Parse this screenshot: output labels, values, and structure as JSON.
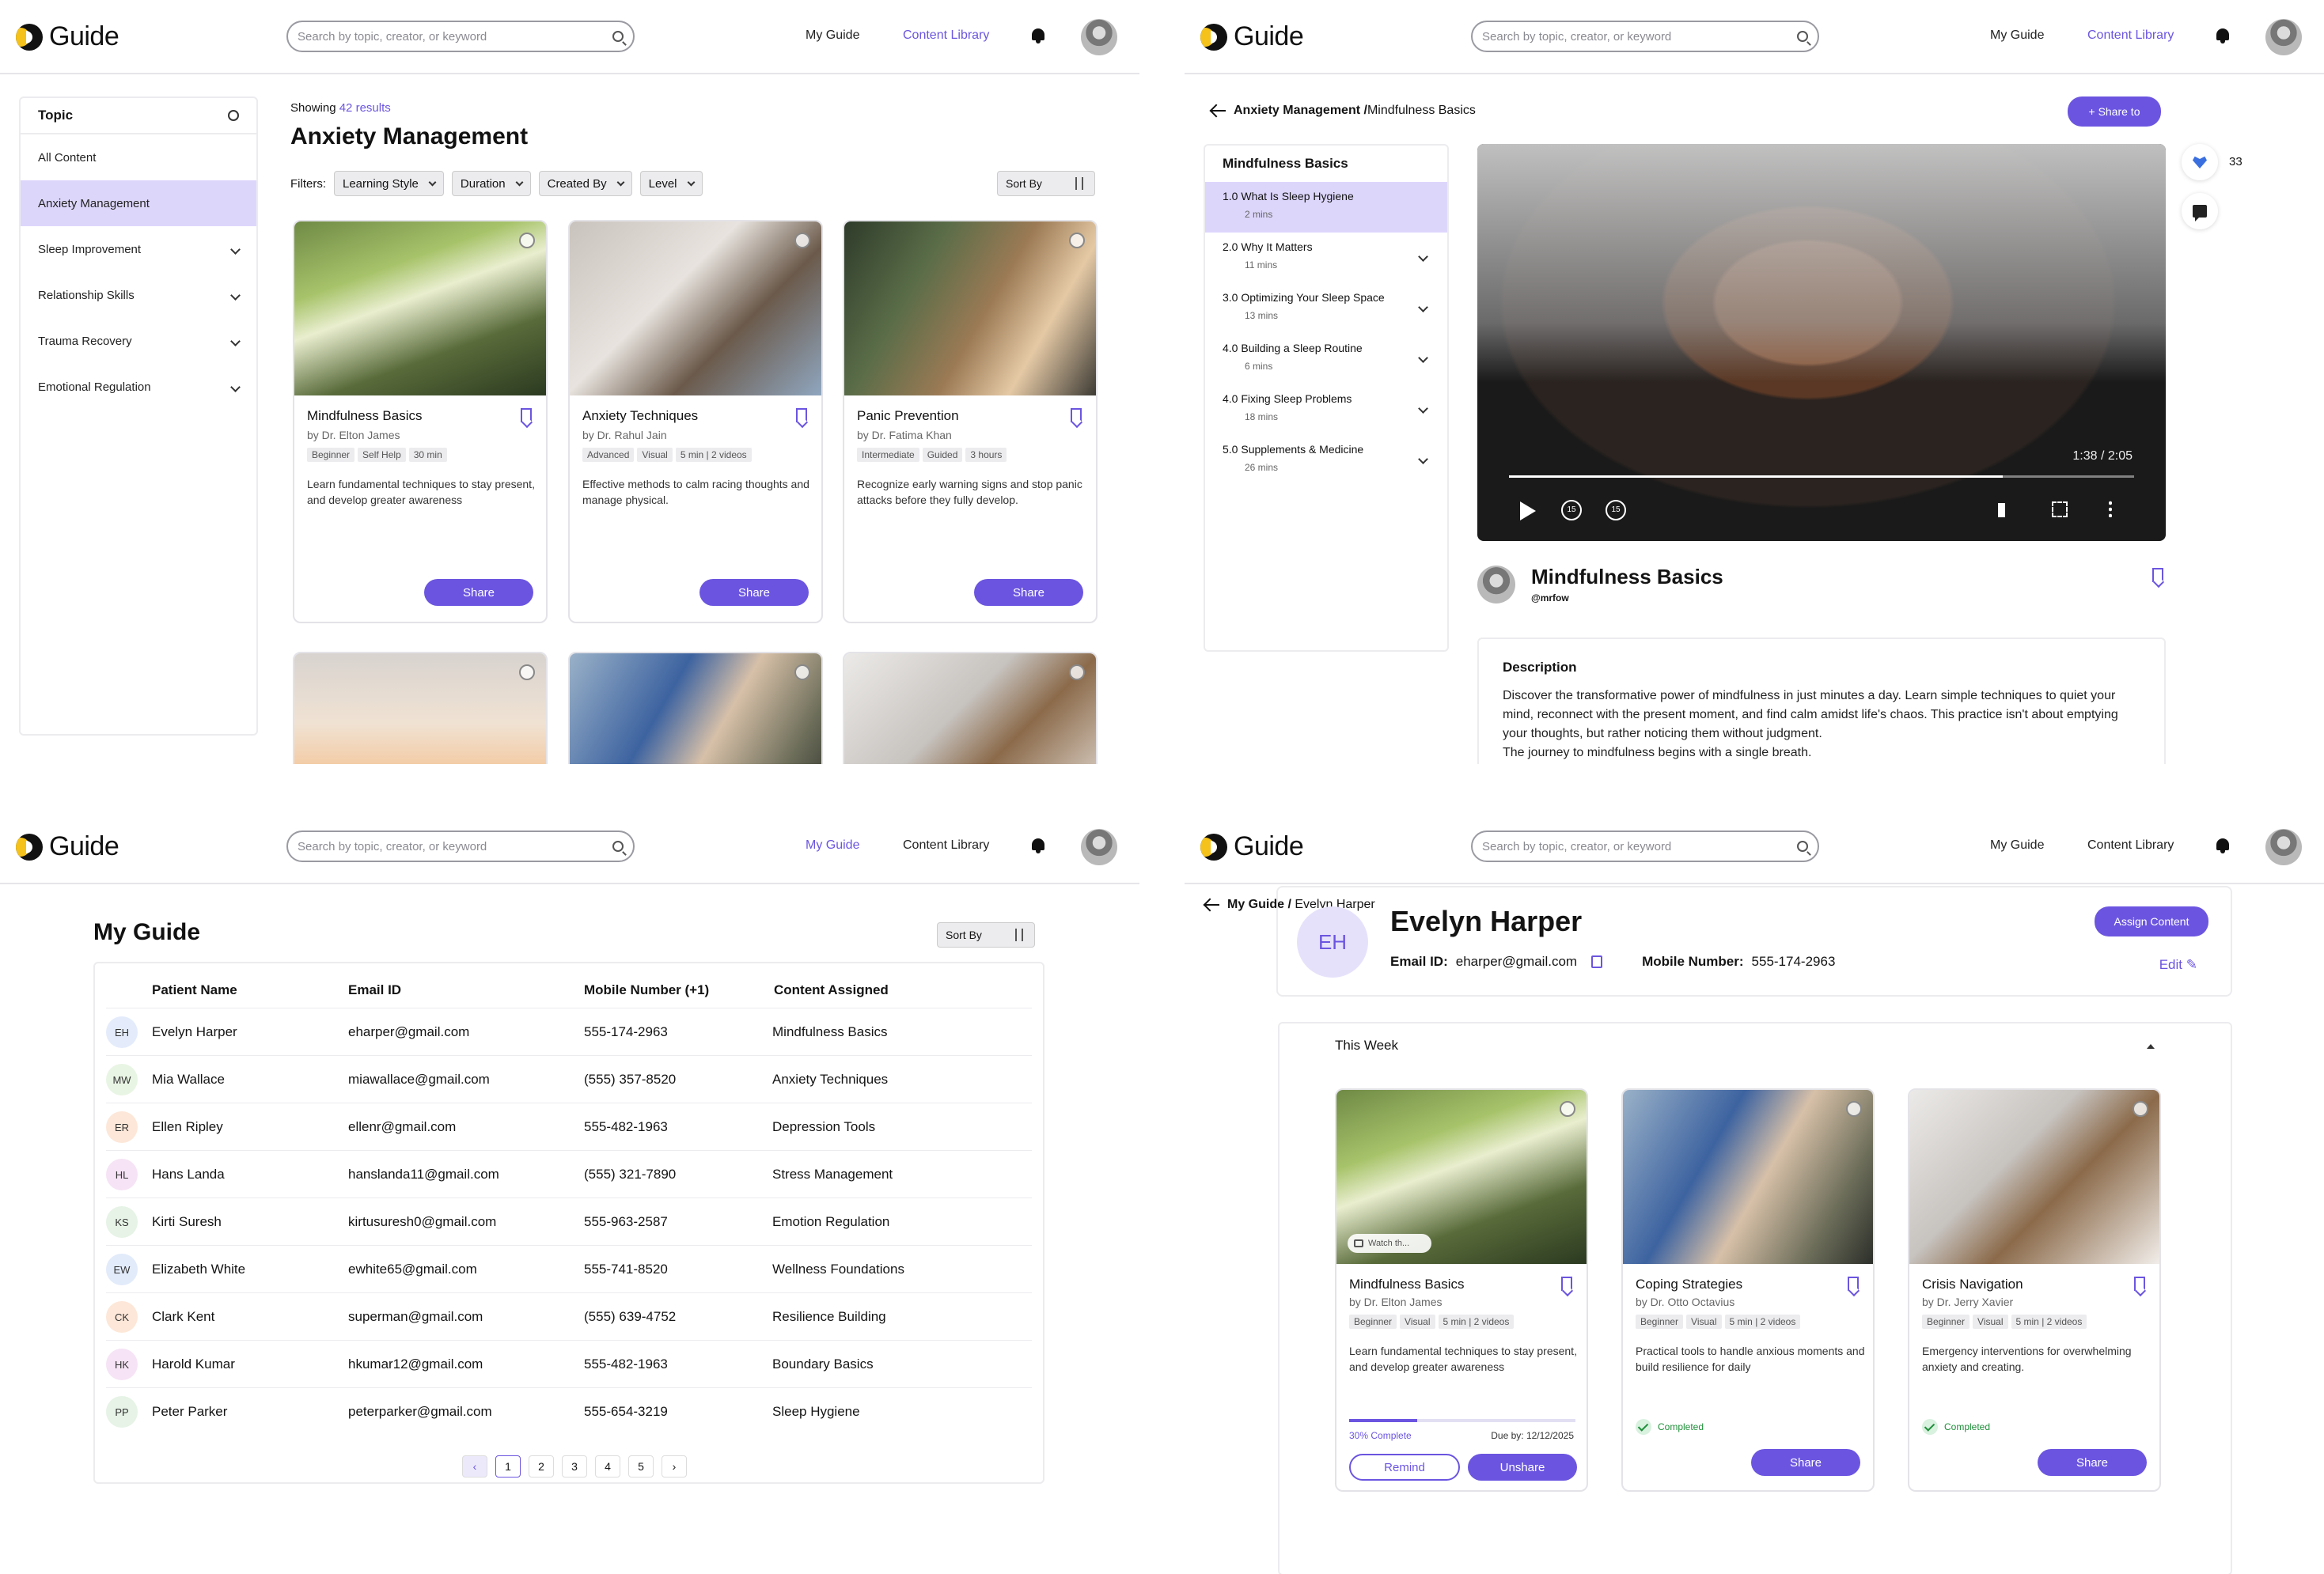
{
  "common": {
    "brand": "Guide",
    "search_placeholder": "Search by topic, creator, or keyword",
    "nav_my_guide": "My Guide",
    "nav_content_library": "Content Library",
    "accent": "#6b55e0"
  },
  "library": {
    "topic_header": "Topic",
    "topics": [
      "All Content",
      "Anxiety Management",
      "Sleep Improvement",
      "Relationship Skills",
      "Trauma Recovery",
      "Emotional Regulation"
    ],
    "selected_topic": "Anxiety Management",
    "showing_prefix": "Showing",
    "results": "42 results",
    "title": "Anxiety Management",
    "filters_label": "Filters:",
    "filters": [
      "Learning Style",
      "Duration",
      "Created By",
      "Level"
    ],
    "sort_by": "Sort By",
    "share_label": "Share",
    "cards": [
      {
        "title": "Mindfulness Basics",
        "author": "by Dr. Elton James",
        "tags": [
          "Beginner",
          "Self Help",
          "30 min"
        ],
        "desc": "Learn fundamental techniques to stay present, and develop greater awareness"
      },
      {
        "title": "Anxiety Techniques",
        "author": "by Dr. Rahul Jain",
        "tags": [
          "Advanced",
          "Visual",
          "5 min | 2 videos"
        ],
        "desc": "Effective methods to calm racing thoughts and manage physical."
      },
      {
        "title": "Panic Prevention",
        "author": "by Dr. Fatima Khan",
        "tags": [
          "Intermediate",
          "Guided",
          "3 hours"
        ],
        "desc": "Recognize early warning signs and stop panic attacks before they fully develop."
      }
    ]
  },
  "detail": {
    "breadcrumb_parent": "Anxiety Management /",
    "breadcrumb_current": "Mindfulness Basics",
    "share_to": "Share to",
    "curriculum_title": "Mindfulness Basics",
    "lessons": [
      {
        "title": "1.0 What Is Sleep Hygiene",
        "duration": "2 mins"
      },
      {
        "title": "2.0 Why It Matters",
        "duration": "11 mins"
      },
      {
        "title": "3.0 Optimizing Your Sleep Space",
        "duration": "13 mins"
      },
      {
        "title": "4.0 Building a Sleep Routine",
        "duration": "6 mins"
      },
      {
        "title": "4.0 Fixing Sleep Problems",
        "duration": "18 mins"
      },
      {
        "title": "5.0 Supplements & Medicine",
        "duration": "26 mins"
      }
    ],
    "video_time": "1:38 / 2:05",
    "video_progress": 0.79,
    "skip_back": "15",
    "skip_forward": "15",
    "likes": "33",
    "owner_title": "Mindfulness Basics",
    "owner_handle": "@mrfow",
    "description_title": "Description",
    "description": "Discover the transformative power of mindfulness in just minutes a day. Learn simple techniques to quiet your mind, reconnect with the present moment, and find calm amidst life's chaos. This practice isn't about emptying your thoughts, but rather noticing them without judgment.",
    "description_2": "The journey to mindfulness begins with a single breath."
  },
  "my_guide": {
    "title": "My Guide",
    "sort_by": "Sort By",
    "columns": [
      "Patient Name",
      "Email ID",
      "Mobile Number (+1)",
      "Content Assigned"
    ],
    "rows": [
      {
        "initials": "EH",
        "name": "Evelyn Harper",
        "email": "eharper@gmail.com",
        "mobile": "555-174-2963",
        "content": "Mindfulness Basics",
        "color": "#e4ecfb"
      },
      {
        "initials": "MW",
        "name": "Mia Wallace",
        "email": "miawallace@gmail.com",
        "mobile": "(555) 357-8520",
        "content": "Anxiety Techniques",
        "color": "#e9f5e4"
      },
      {
        "initials": "ER",
        "name": "Ellen Ripley",
        "email": "ellenr@gmail.com",
        "mobile": "555-482-1963",
        "content": "Depression Tools",
        "color": "#fde7d8"
      },
      {
        "initials": "HL",
        "name": "Hans Landa",
        "email": "hanslanda11@gmail.com",
        "mobile": "(555) 321-7890",
        "content": "Stress Management",
        "color": "#f6e3f5"
      },
      {
        "initials": "KS",
        "name": "Kirti Suresh",
        "email": "kirtusuresh0@gmail.com",
        "mobile": "555-963-2587",
        "content": "Emotion Regulation",
        "color": "#e6f3e6"
      },
      {
        "initials": "EW",
        "name": "Elizabeth White",
        "email": "ewhite65@gmail.com",
        "mobile": "555-741-8520",
        "content": "Wellness Foundations",
        "color": "#e2ebfa"
      },
      {
        "initials": "CK",
        "name": "Clark Kent",
        "email": "superman@gmail.com",
        "mobile": "(555) 639-4752",
        "content": "Resilience Building",
        "color": "#fde7d8"
      },
      {
        "initials": "HK",
        "name": "Harold Kumar",
        "email": "hkumar12@gmail.com",
        "mobile": "555-482-1963",
        "content": "Boundary Basics",
        "color": "#f6e3f5"
      },
      {
        "initials": "PP",
        "name": "Peter Parker",
        "email": "peterparker@gmail.com",
        "mobile": "555-654-3219",
        "content": "Sleep Hygiene",
        "color": "#e6f3e6"
      }
    ],
    "pages": [
      "1",
      "2",
      "3",
      "4",
      "5"
    ],
    "current_page": "1"
  },
  "patient": {
    "breadcrumb_parent": "My Guide /",
    "breadcrumb_current": "Evelyn Harper",
    "initials": "EH",
    "name": "Evelyn Harper",
    "email_label": "Email ID:",
    "email": "eharper@gmail.com",
    "mobile_label": "Mobile Number:",
    "mobile": "555-174-2963",
    "assign_content": "Assign Content",
    "edit": "Edit",
    "week_title": "This Week",
    "cards": [
      {
        "title": "Mindfulness Basics",
        "author": "by Dr. Elton James",
        "tags": [
          "Beginner",
          "Visual",
          "5 min | 2 videos"
        ],
        "desc": "Learn fundamental techniques to stay present, and develop greater awareness",
        "watch": "Watch th...",
        "progress_label": "30% Complete",
        "progress": 0.3,
        "due": "Due by: 12/12/2025",
        "remind": "Remind",
        "unshare": "Unshare"
      },
      {
        "title": "Coping Strategies",
        "author": "by Dr. Otto Octavius",
        "tags": [
          "Beginner",
          "Visual",
          "5 min | 2 videos"
        ],
        "desc": "Practical tools to handle anxious moments and build resilience for daily",
        "status": "Completed",
        "share": "Share"
      },
      {
        "title": "Crisis Navigation",
        "author": "by Dr. Jerry Xavier",
        "tags": [
          "Beginner",
          "Visual",
          "5 min | 2 videos"
        ],
        "desc": "Emergency interventions for overwhelming anxiety and creating.",
        "status": "Completed",
        "share": "Share"
      }
    ]
  }
}
